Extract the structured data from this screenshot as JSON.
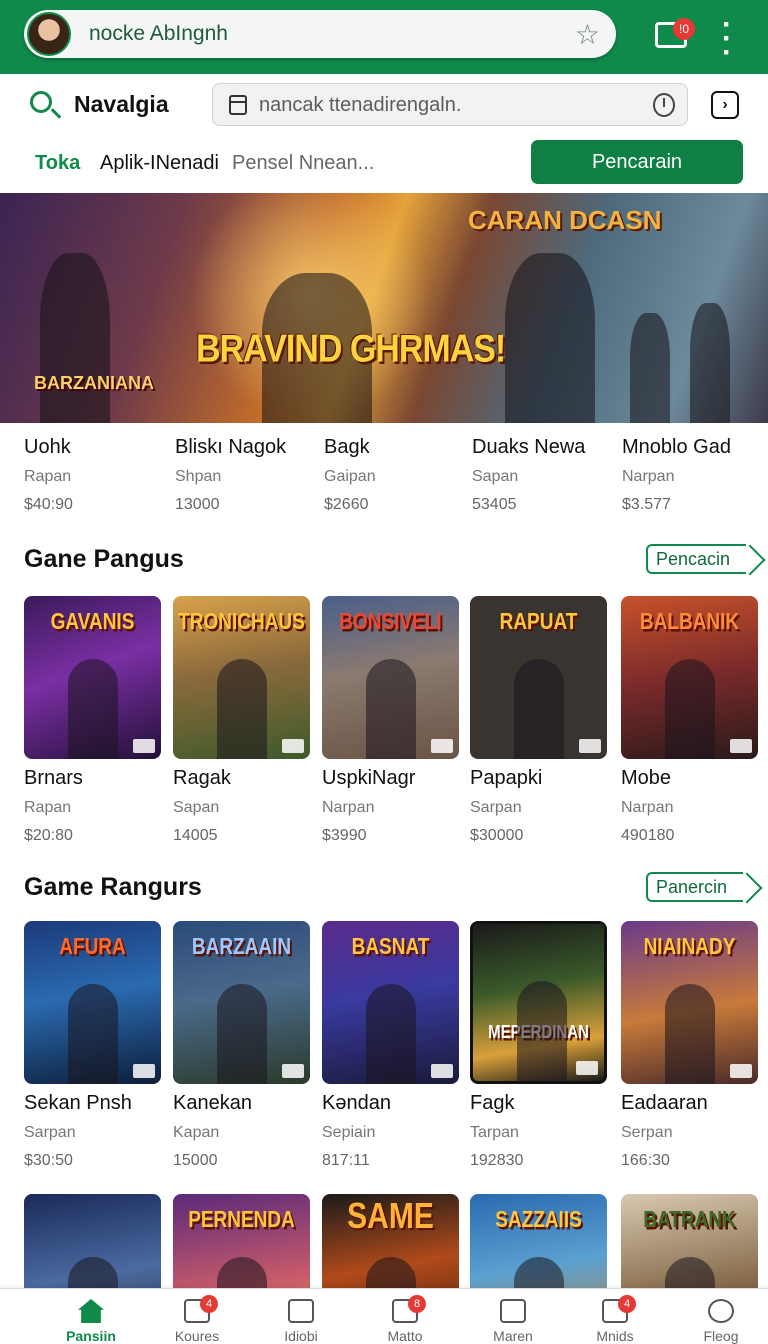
{
  "topbar": {
    "address": "nocke AbIngnh",
    "tab_badge": "!0"
  },
  "search_bar": {
    "brand": "Navalgia",
    "placeholder": "nancak ttenadirengaln."
  },
  "categories": {
    "active": "Toka",
    "items": [
      "Aplik-INenadi",
      "Pensel Nnean..."
    ],
    "cta_label": "Pencarain"
  },
  "hero": {
    "title": "BRAVIND GHRMAS!",
    "right_logo": "CARAN DCASN",
    "left_logo": "BARZANIANA"
  },
  "featured": [
    {
      "name": "Uohk",
      "sub": "Rapan",
      "price": "$40:90"
    },
    {
      "name": "Bliskı Nagok",
      "sub": "Shpan",
      "price": "13000"
    },
    {
      "name": "Bagk",
      "sub": "Gaipan",
      "price": "$2660"
    },
    {
      "name": "Duaks Newa",
      "sub": "Sapan",
      "price": "53405"
    },
    {
      "name": "Mnoblo Gad",
      "sub": "Narpan",
      "price": "$3.577"
    }
  ],
  "section1": {
    "title": "Gane Pangus",
    "button": "Pencacin",
    "games": [
      {
        "logo": "GAVANIS",
        "name": "Brnars",
        "sub": "Rapan",
        "price": "$20:80"
      },
      {
        "logo": "TRONICHAUS",
        "name": "Ragak",
        "sub": "Sapan",
        "price": "14005"
      },
      {
        "logo": "BONSIVELI",
        "name": "UspkiNagr",
        "sub": "Narpan",
        "price": "$3990"
      },
      {
        "logo": "RAPUAT",
        "name": "Papapki",
        "sub": "Sarpan",
        "price": "$30000"
      },
      {
        "logo": "BALBANIK",
        "name": "Mobe",
        "sub": "Narpan",
        "price": "490180"
      }
    ]
  },
  "section2": {
    "title": "Game Rangurs",
    "button": "Panercin",
    "games": [
      {
        "logo": "AFURA",
        "name": "Sekan Pnsh",
        "sub": "Sarpan",
        "price": "$30:50"
      },
      {
        "logo": "BARZAAIN",
        "name": "Kanekan",
        "sub": "Kapan",
        "price": "15000"
      },
      {
        "logo": "BASNAT",
        "name": "Kəndan",
        "sub": "Sepiain",
        "price": "817:11"
      },
      {
        "logo": "MEPERDINAN",
        "name": "Fagk",
        "sub": "Tarpan",
        "price": "192830"
      },
      {
        "logo": "NIAINADY",
        "name": "Eadaaran",
        "sub": "Serpan",
        "price": "166:30"
      }
    ]
  },
  "section3": {
    "games": [
      {
        "logo": ""
      },
      {
        "logo": "PERNENDA"
      },
      {
        "logo": "SAME"
      },
      {
        "logo": "SAZZAIIS"
      },
      {
        "logo": "BATRANK"
      }
    ]
  },
  "bottom_nav": [
    {
      "label": "Pansiin",
      "badge": ""
    },
    {
      "label": "Koures",
      "badge": "4"
    },
    {
      "label": "Idiobi",
      "badge": ""
    },
    {
      "label": "Matto",
      "badge": "8"
    },
    {
      "label": "Maren",
      "badge": ""
    },
    {
      "label": "Mnids",
      "badge": "4"
    },
    {
      "label": "Fleog",
      "badge": ""
    }
  ],
  "colors": {
    "brand_green": "#0f8a4a",
    "badge_red": "#e53935"
  }
}
